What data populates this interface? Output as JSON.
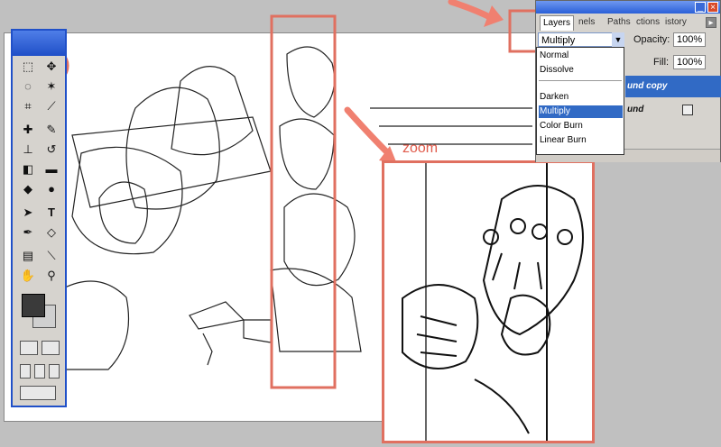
{
  "layers_panel": {
    "tabs": [
      "Layers",
      "Channels",
      "Paths",
      "Actions",
      "History"
    ],
    "tabs_visible": [
      "Layers",
      "nels",
      "Paths",
      "ctions",
      "istory"
    ],
    "blend_mode": "Multiply",
    "opacity_label": "Opacity:",
    "opacity_value": "100%",
    "fill_label": "Fill:",
    "fill_value": "100%",
    "layer_rows": [
      "und copy",
      "und"
    ]
  },
  "blend_options": [
    "Normal",
    "Dissolve",
    "Darken",
    "Multiply",
    "Color Burn",
    "Linear Burn"
  ],
  "zoom_label": "zoom",
  "colors": {
    "accent_blue": "#2050c8",
    "highlight_red": "#e07060",
    "selection": "#316ac5"
  },
  "toolbox": {
    "tools": [
      "marquee-icon",
      "move-icon",
      "lasso-icon",
      "magic-wand-icon",
      "crop-icon",
      "slice-icon",
      "healing-brush-icon",
      "brush-icon",
      "clone-stamp-icon",
      "history-brush-icon",
      "eraser-icon",
      "gradient-icon",
      "blur-icon",
      "dodge-icon",
      "path-select-icon",
      "type-icon",
      "pen-icon",
      "shape-icon",
      "notes-icon",
      "eyedropper-icon",
      "hand-icon",
      "zoom-icon"
    ]
  }
}
